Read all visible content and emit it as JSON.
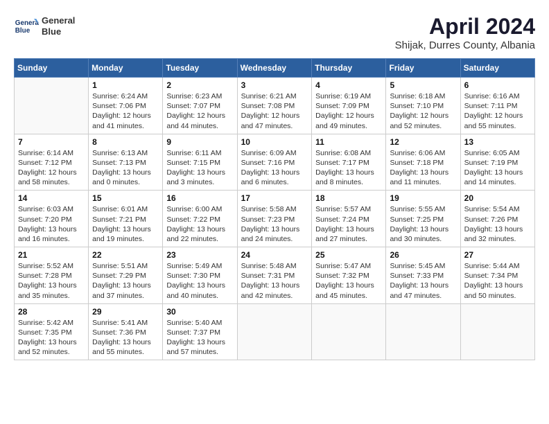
{
  "header": {
    "logo_line1": "General",
    "logo_line2": "Blue",
    "month_year": "April 2024",
    "location": "Shijak, Durres County, Albania"
  },
  "weekdays": [
    "Sunday",
    "Monday",
    "Tuesday",
    "Wednesday",
    "Thursday",
    "Friday",
    "Saturday"
  ],
  "weeks": [
    [
      {
        "day": "",
        "info": ""
      },
      {
        "day": "1",
        "info": "Sunrise: 6:24 AM\nSunset: 7:06 PM\nDaylight: 12 hours\nand 41 minutes."
      },
      {
        "day": "2",
        "info": "Sunrise: 6:23 AM\nSunset: 7:07 PM\nDaylight: 12 hours\nand 44 minutes."
      },
      {
        "day": "3",
        "info": "Sunrise: 6:21 AM\nSunset: 7:08 PM\nDaylight: 12 hours\nand 47 minutes."
      },
      {
        "day": "4",
        "info": "Sunrise: 6:19 AM\nSunset: 7:09 PM\nDaylight: 12 hours\nand 49 minutes."
      },
      {
        "day": "5",
        "info": "Sunrise: 6:18 AM\nSunset: 7:10 PM\nDaylight: 12 hours\nand 52 minutes."
      },
      {
        "day": "6",
        "info": "Sunrise: 6:16 AM\nSunset: 7:11 PM\nDaylight: 12 hours\nand 55 minutes."
      }
    ],
    [
      {
        "day": "7",
        "info": "Sunrise: 6:14 AM\nSunset: 7:12 PM\nDaylight: 12 hours\nand 58 minutes."
      },
      {
        "day": "8",
        "info": "Sunrise: 6:13 AM\nSunset: 7:13 PM\nDaylight: 13 hours\nand 0 minutes."
      },
      {
        "day": "9",
        "info": "Sunrise: 6:11 AM\nSunset: 7:15 PM\nDaylight: 13 hours\nand 3 minutes."
      },
      {
        "day": "10",
        "info": "Sunrise: 6:09 AM\nSunset: 7:16 PM\nDaylight: 13 hours\nand 6 minutes."
      },
      {
        "day": "11",
        "info": "Sunrise: 6:08 AM\nSunset: 7:17 PM\nDaylight: 13 hours\nand 8 minutes."
      },
      {
        "day": "12",
        "info": "Sunrise: 6:06 AM\nSunset: 7:18 PM\nDaylight: 13 hours\nand 11 minutes."
      },
      {
        "day": "13",
        "info": "Sunrise: 6:05 AM\nSunset: 7:19 PM\nDaylight: 13 hours\nand 14 minutes."
      }
    ],
    [
      {
        "day": "14",
        "info": "Sunrise: 6:03 AM\nSunset: 7:20 PM\nDaylight: 13 hours\nand 16 minutes."
      },
      {
        "day": "15",
        "info": "Sunrise: 6:01 AM\nSunset: 7:21 PM\nDaylight: 13 hours\nand 19 minutes."
      },
      {
        "day": "16",
        "info": "Sunrise: 6:00 AM\nSunset: 7:22 PM\nDaylight: 13 hours\nand 22 minutes."
      },
      {
        "day": "17",
        "info": "Sunrise: 5:58 AM\nSunset: 7:23 PM\nDaylight: 13 hours\nand 24 minutes."
      },
      {
        "day": "18",
        "info": "Sunrise: 5:57 AM\nSunset: 7:24 PM\nDaylight: 13 hours\nand 27 minutes."
      },
      {
        "day": "19",
        "info": "Sunrise: 5:55 AM\nSunset: 7:25 PM\nDaylight: 13 hours\nand 30 minutes."
      },
      {
        "day": "20",
        "info": "Sunrise: 5:54 AM\nSunset: 7:26 PM\nDaylight: 13 hours\nand 32 minutes."
      }
    ],
    [
      {
        "day": "21",
        "info": "Sunrise: 5:52 AM\nSunset: 7:28 PM\nDaylight: 13 hours\nand 35 minutes."
      },
      {
        "day": "22",
        "info": "Sunrise: 5:51 AM\nSunset: 7:29 PM\nDaylight: 13 hours\nand 37 minutes."
      },
      {
        "day": "23",
        "info": "Sunrise: 5:49 AM\nSunset: 7:30 PM\nDaylight: 13 hours\nand 40 minutes."
      },
      {
        "day": "24",
        "info": "Sunrise: 5:48 AM\nSunset: 7:31 PM\nDaylight: 13 hours\nand 42 minutes."
      },
      {
        "day": "25",
        "info": "Sunrise: 5:47 AM\nSunset: 7:32 PM\nDaylight: 13 hours\nand 45 minutes."
      },
      {
        "day": "26",
        "info": "Sunrise: 5:45 AM\nSunset: 7:33 PM\nDaylight: 13 hours\nand 47 minutes."
      },
      {
        "day": "27",
        "info": "Sunrise: 5:44 AM\nSunset: 7:34 PM\nDaylight: 13 hours\nand 50 minutes."
      }
    ],
    [
      {
        "day": "28",
        "info": "Sunrise: 5:42 AM\nSunset: 7:35 PM\nDaylight: 13 hours\nand 52 minutes."
      },
      {
        "day": "29",
        "info": "Sunrise: 5:41 AM\nSunset: 7:36 PM\nDaylight: 13 hours\nand 55 minutes."
      },
      {
        "day": "30",
        "info": "Sunrise: 5:40 AM\nSunset: 7:37 PM\nDaylight: 13 hours\nand 57 minutes."
      },
      {
        "day": "",
        "info": ""
      },
      {
        "day": "",
        "info": ""
      },
      {
        "day": "",
        "info": ""
      },
      {
        "day": "",
        "info": ""
      }
    ]
  ]
}
